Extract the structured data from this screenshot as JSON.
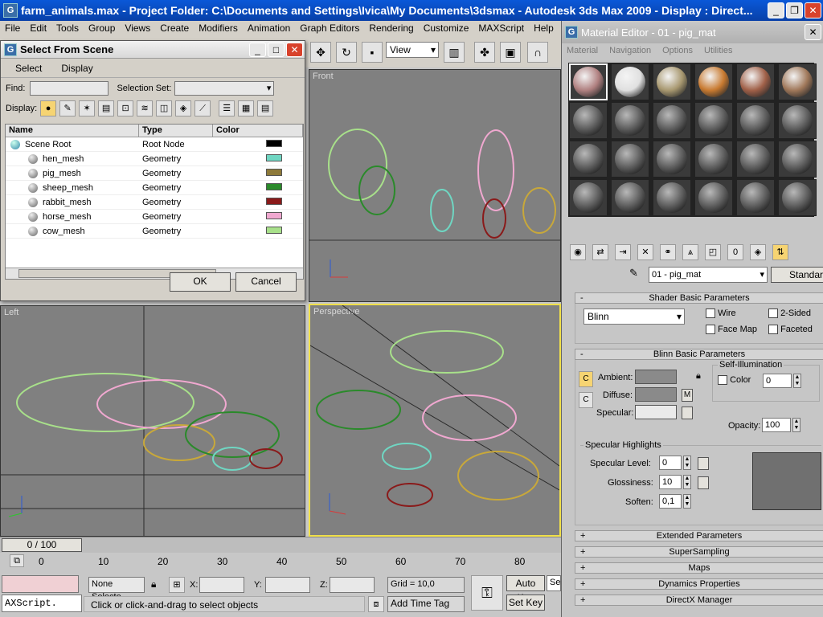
{
  "app": {
    "title": "farm_animals.max   - Project Folder: C:\\Documents and Settings\\Ivica\\My Documents\\3dsmax   - Autodesk 3ds Max  2009    - Display : Direct..."
  },
  "menu": [
    "File",
    "Edit",
    "Tools",
    "Group",
    "Views",
    "Create",
    "Modifiers",
    "Animation",
    "Graph Editors",
    "Rendering",
    "Customize",
    "MAXScript",
    "Help"
  ],
  "toolbar": {
    "view_dropdown": "View"
  },
  "select_dialog": {
    "title": "Select From Scene",
    "menu": [
      "Select",
      "Display"
    ],
    "find_label": "Find:",
    "selection_set_label": "Selection Set:",
    "display_label": "Display:",
    "columns": [
      "Name",
      "Type",
      "Color"
    ],
    "rows": [
      {
        "name": "Scene Root",
        "type": "Root Node",
        "color": "#000000"
      },
      {
        "name": "hen_mesh",
        "type": "Geometry",
        "color": "#6fd6c2"
      },
      {
        "name": "pig_mesh",
        "type": "Geometry",
        "color": "#8e7a3a"
      },
      {
        "name": "sheep_mesh",
        "type": "Geometry",
        "color": "#2a8a2a"
      },
      {
        "name": "rabbit_mesh",
        "type": "Geometry",
        "color": "#8a1a1a"
      },
      {
        "name": "horse_mesh",
        "type": "Geometry",
        "color": "#f0a8d0"
      },
      {
        "name": "cow_mesh",
        "type": "Geometry",
        "color": "#a8e08a"
      }
    ],
    "ok": "OK",
    "cancel": "Cancel"
  },
  "viewports": {
    "front": "Front",
    "left": "Left",
    "perspective": "Perspective"
  },
  "material_editor": {
    "title": "Material Editor - 01 - pig_mat",
    "menu": [
      "Material",
      "Navigation",
      "Options",
      "Utilities"
    ],
    "material_name": "01 - pig_mat",
    "type_button": "Standard",
    "shader_rollout": "Shader Basic Parameters",
    "shader": "Blinn",
    "wire": "Wire",
    "two_sided": "2-Sided",
    "face_map": "Face Map",
    "faceted": "Faceted",
    "blinn_rollout": "Blinn Basic Parameters",
    "self_illum": "Self-Illumination",
    "color": "Color",
    "color_value": "0",
    "ambient": "Ambient:",
    "diffuse": "Diffuse:",
    "specular": "Specular:",
    "m_button": "M",
    "opacity": "Opacity:",
    "opacity_value": "100",
    "spec_highlights": "Specular Highlights",
    "spec_level": "Specular Level:",
    "spec_level_value": "0",
    "glossiness": "Glossiness:",
    "glossiness_value": "10",
    "soften": "Soften:",
    "soften_value": "0,1",
    "rollouts": [
      "Extended Parameters",
      "SuperSampling",
      "Maps",
      "Dynamics Properties",
      "DirectX Manager"
    ]
  },
  "timeline": {
    "slider": "0 / 100",
    "ticks": [
      "0",
      "10",
      "20",
      "30",
      "40",
      "50",
      "60",
      "70",
      "80"
    ]
  },
  "status": {
    "maxscript": "AXScript.",
    "selection": "None Selecte",
    "x_label": "X:",
    "y_label": "Y:",
    "z_label": "Z:",
    "grid": "Grid = 10,0",
    "auto_key": "Auto Key",
    "set_key": "Set Key",
    "set_partial": "Se",
    "prompt": "Click or click-and-drag to select objects",
    "add_time_tag": "Add Time Tag"
  },
  "colors": {
    "selected_viewport": "#f0e04a",
    "grid_line": "#2a2a2a"
  }
}
